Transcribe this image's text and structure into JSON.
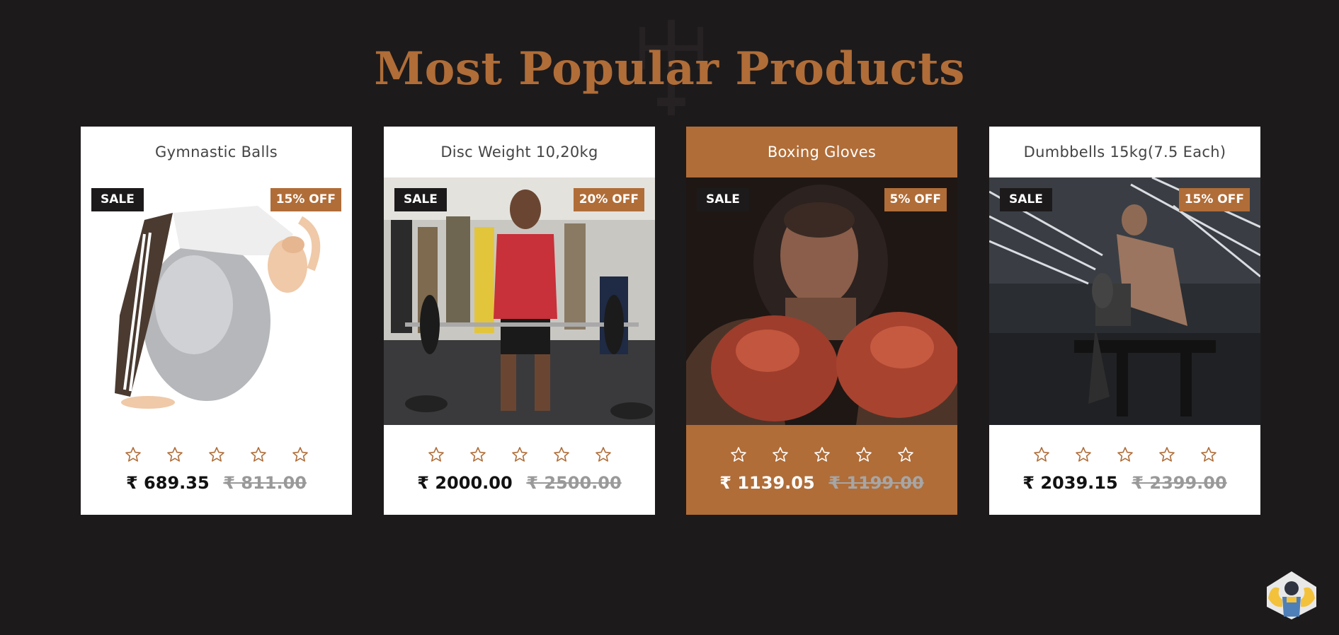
{
  "section": {
    "title": "Most Popular Products"
  },
  "colors": {
    "accent": "#b06d38",
    "background": "#1d1a1b",
    "card": "#ffffff"
  },
  "products": [
    {
      "name": "Gymnastic Balls",
      "sale_label": "SALE",
      "discount_label": "15% OFF",
      "rating": 0,
      "price": "₹ 689.35",
      "old_price": "₹ 811.00",
      "featured": false,
      "image": "gymnastic-ball-photo"
    },
    {
      "name": "Disc Weight 10,20kg",
      "sale_label": "SALE",
      "discount_label": "20% OFF",
      "rating": 0,
      "price": "₹ 2000.00",
      "old_price": "₹ 2500.00",
      "featured": false,
      "image": "deadlift-gym-photo"
    },
    {
      "name": "Boxing Gloves",
      "sale_label": "SALE",
      "discount_label": "5% OFF",
      "rating": 0,
      "price": "₹ 1139.05",
      "old_price": "₹ 1199.00",
      "featured": true,
      "image": "boxer-gloves-photo"
    },
    {
      "name": "Dumbbells 15kg(7.5 Each)",
      "sale_label": "SALE",
      "discount_label": "15% OFF",
      "rating": 0,
      "price": "₹ 2039.15",
      "old_price": "₹ 2399.00",
      "featured": false,
      "image": "dumbbell-row-gym-photo"
    }
  ],
  "icons": {
    "star": "star-outline-icon",
    "mascot": "strongman-mascot-icon"
  }
}
